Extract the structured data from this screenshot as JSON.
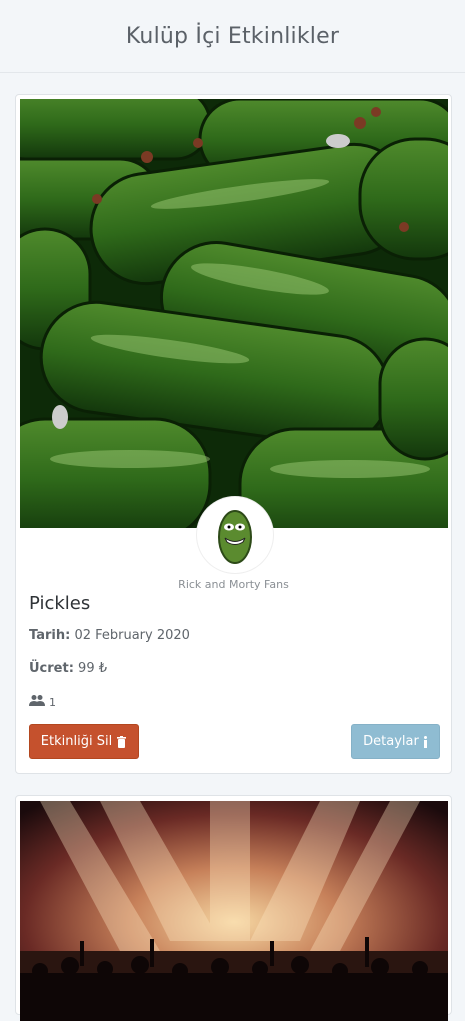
{
  "header": {
    "title": "Kulüp İçi Etkinlikler"
  },
  "events": [
    {
      "club_name": "Rick and Morty Fans",
      "title": "Pickles",
      "date_label": "Tarih:",
      "date_value": "02 February 2020",
      "fee_label": "Ücret:",
      "fee_value": "99 ₺",
      "participants": "1",
      "delete_label": "Etkinliği Sil",
      "detail_label": "Detaylar",
      "photo_alt": "pickles-photo"
    },
    {
      "photo_alt": "concert-photo"
    }
  ],
  "icons": {
    "users": "users-icon",
    "trash": "trash-icon",
    "info": "info-icon"
  },
  "colors": {
    "delete": "#c5512d",
    "detail": "#8fbcd2"
  }
}
